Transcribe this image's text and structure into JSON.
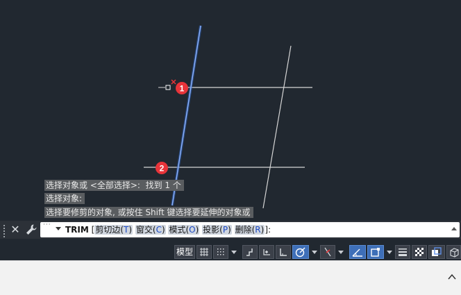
{
  "history": [
    "选择对象或 <全部选择>:  找到 1 个",
    "选择对象:",
    "选择要修剪的对象, 或按住 Shift 键选择要延伸的对象或"
  ],
  "command": {
    "name": "TRIM",
    "open": " [",
    "options": [
      {
        "label": "剪切边(",
        "key": "T",
        "close": ")"
      },
      {
        "label": "窗交(",
        "key": "C",
        "close": ")"
      },
      {
        "label": "模式(",
        "key": "O",
        "close": ")"
      },
      {
        "label": "投影(",
        "key": "P",
        "close": ")"
      },
      {
        "label": "删除(",
        "key": "R",
        "close": ")"
      }
    ],
    "end": "]:"
  },
  "markers": [
    {
      "number": "1"
    },
    {
      "number": "2"
    }
  ],
  "status": {
    "model_label": "模型"
  },
  "colors": {
    "canvas": "#212830",
    "line": "#d6d6d6",
    "selected_line": "#5f8fe6",
    "marker": "#e8343a",
    "pickbox_x": "#e8343a"
  },
  "icons": {
    "close": "close-icon",
    "wrench": "wrench-icon",
    "expand": "chevron-up-icon"
  }
}
